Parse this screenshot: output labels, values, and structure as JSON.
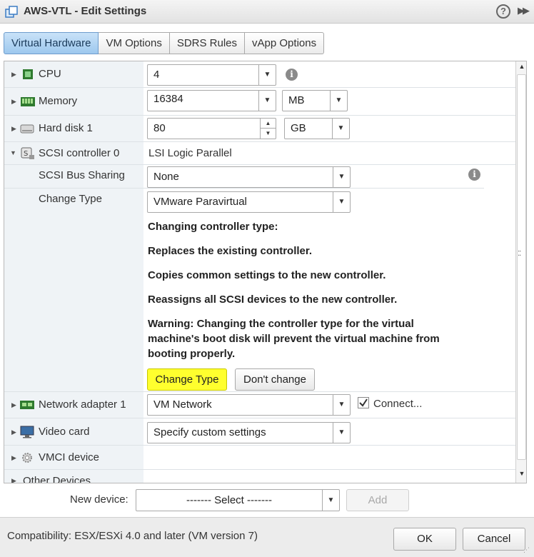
{
  "window": {
    "title": "AWS-VTL - Edit Settings",
    "help": "?"
  },
  "tabs": [
    {
      "label": "Virtual Hardware",
      "active": true
    },
    {
      "label": "VM Options",
      "active": false
    },
    {
      "label": "SDRS Rules",
      "active": false
    },
    {
      "label": "vApp Options",
      "active": false
    }
  ],
  "hardware": {
    "cpu": {
      "label": "CPU",
      "value": "4"
    },
    "memory": {
      "label": "Memory",
      "value": "16384",
      "unit": "MB"
    },
    "hard_disk": {
      "label": "Hard disk 1",
      "value": "80",
      "unit": "GB"
    },
    "scsi": {
      "label": "SCSI controller 0",
      "value": "LSI Logic Parallel",
      "bus_sharing": {
        "label": "SCSI Bus Sharing",
        "value": "None"
      },
      "change_type": {
        "label": "Change Type",
        "value": "VMware Paravirtual",
        "messages": [
          "Changing controller type:",
          "Replaces the existing controller.",
          "Copies common settings to the new controller.",
          "Reassigns all SCSI devices to the new controller."
        ],
        "warning_lines": [
          "Warning: Changing the controller type for the virtual",
          "machine's boot disk will prevent the virtual machine from",
          "booting properly."
        ],
        "confirm_label": "Change Type",
        "cancel_label": "Don't change"
      }
    },
    "network": {
      "label": "Network adapter 1",
      "value": "VM Network",
      "connect_label": "Connect...",
      "connected": true
    },
    "video": {
      "label": "Video card",
      "value": "Specify custom settings"
    },
    "vmci": {
      "label": "VMCI device"
    },
    "other": {
      "label": "Other Devices"
    }
  },
  "new_device": {
    "label": "New device:",
    "select_value": "------- Select -------",
    "add_label": "Add"
  },
  "footer": {
    "compatibility": "Compatibility: ESX/ESXi 4.0 and later (VM version 7)",
    "ok_label": "OK",
    "cancel_label": "Cancel"
  },
  "colors": {
    "active_tab": "#9dc8ee",
    "highlight_button": "#ffff2e",
    "label_column": "#eff3f6"
  },
  "icons": [
    "vm-icon",
    "help-icon",
    "expand-icon",
    "cpu-icon",
    "memory-icon",
    "hard-disk-icon",
    "scsi-controller-icon",
    "network-adapter-icon",
    "video-card-icon",
    "vmci-icon",
    "info-icon",
    "chevron-down-icon",
    "checkbox-icon"
  ]
}
